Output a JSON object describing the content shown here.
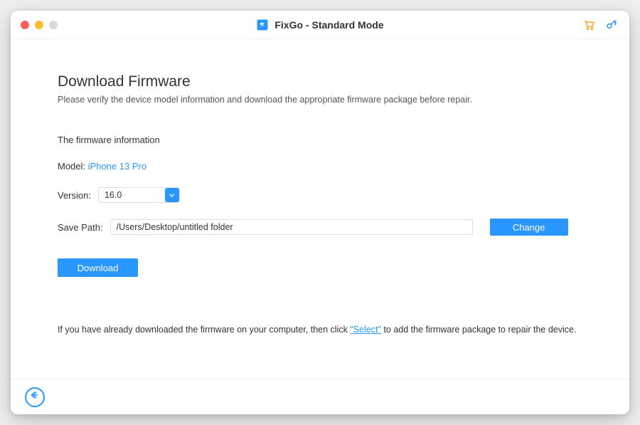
{
  "titlebar": {
    "app_title": "FixGo - Standard Mode"
  },
  "page": {
    "title": "Download Firmware",
    "subtitle": "Please verify the device model information and download the appropriate firmware package before repair."
  },
  "firmware": {
    "section_title": "The firmware information",
    "model_label": "Model:",
    "model_value": "iPhone 13 Pro",
    "version_label": "Version:",
    "version_value": "16.0",
    "savepath_label": "Save Path:",
    "savepath_value": "/Users/Desktop/untitled folder",
    "change_label": "Change",
    "download_label": "Download"
  },
  "already": {
    "prefix": "If you have already downloaded the firmware on your computer, then click ",
    "select": "\"Select\"",
    "suffix": " to add the firmware package to repair the device."
  }
}
